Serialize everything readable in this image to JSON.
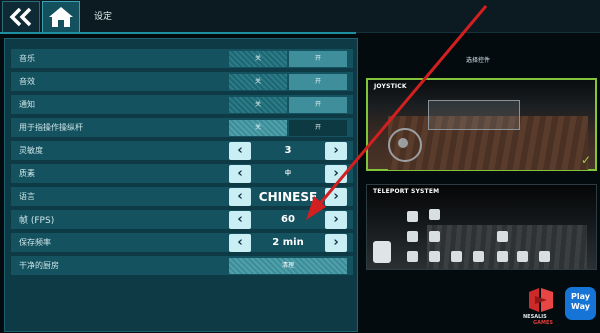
{
  "header": {
    "title": "设定",
    "back_icon": "double-chevron-left-icon",
    "home_icon": "home-icon"
  },
  "settings": {
    "music": {
      "label": "音乐",
      "off": "关",
      "on": "开",
      "selected": "on"
    },
    "sfx": {
      "label": "音效",
      "off": "关",
      "on": "开",
      "selected": "on"
    },
    "notify": {
      "label": "通知",
      "off": "关",
      "on": "开",
      "selected": "on"
    },
    "joystick_toggle": {
      "label": "用于指操作操纵杆",
      "off": "关",
      "on": "开",
      "selected": "off"
    },
    "sensitivity": {
      "label": "灵敏度",
      "value": "3"
    },
    "quality": {
      "label": "质素",
      "value": "中"
    },
    "language": {
      "label": "语言",
      "value": "CHINESE"
    },
    "fps": {
      "label": "帧  (FPS)",
      "value": "60"
    },
    "autosave": {
      "label": "保存频率",
      "value": "2 min"
    },
    "clear": {
      "label": "干净的厨房",
      "button": "清理"
    }
  },
  "controls": {
    "title": "选择控件",
    "joystick": {
      "label": "JOYSTICK",
      "selected": true
    },
    "teleport": {
      "label": "TELEPORT SYSTEM",
      "selected": false
    }
  },
  "logos": {
    "nesalis_1": "NESALIS",
    "nesalis_2": "GAMES",
    "playway_1": "Play",
    "playway_2": "Way"
  },
  "colors": {
    "accent": "#1d8fa0",
    "panel": "#0e3a45",
    "row": "#15525f",
    "selected_border": "#82c43a",
    "annotation": "#d21f1f"
  }
}
